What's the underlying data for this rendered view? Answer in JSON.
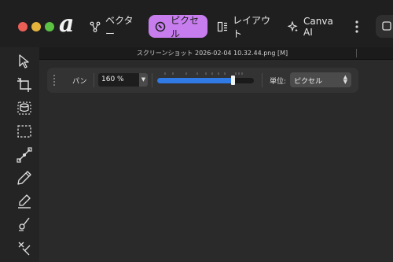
{
  "window": {
    "controls": [
      "close",
      "minimize",
      "zoom"
    ]
  },
  "app": {
    "logo_glyph": "a",
    "logo_icon": "affinity-logo-icon"
  },
  "modes": [
    {
      "label": "ベクター",
      "icon": "vector-nodes-icon",
      "active": false
    },
    {
      "label": "ピクセル",
      "icon": "pixel-brush-icon",
      "active": true
    },
    {
      "label": "レイアウト",
      "icon": "layout-icon",
      "active": false
    },
    {
      "label": "Canva AI",
      "icon": "sparkle-icon",
      "active": false
    }
  ],
  "accent_color": "#c77dee",
  "document": {
    "tab_title": "スクリーンショット 2026-02-04 10.32.44.png [M]"
  },
  "context": {
    "tool_label": "パン",
    "zoom_value": "160 %",
    "zoom_level_fraction": 0.78,
    "slider_color": "#2f7ae5",
    "unit_label": "単位:",
    "unit_value": "ピクセル"
  },
  "tools": [
    "move-icon",
    "crop-icon",
    "selection-brush-icon",
    "marquee-icon",
    "node-icon",
    "pen-icon",
    "pencil-icon",
    "brush-icon",
    "warp-icon"
  ]
}
